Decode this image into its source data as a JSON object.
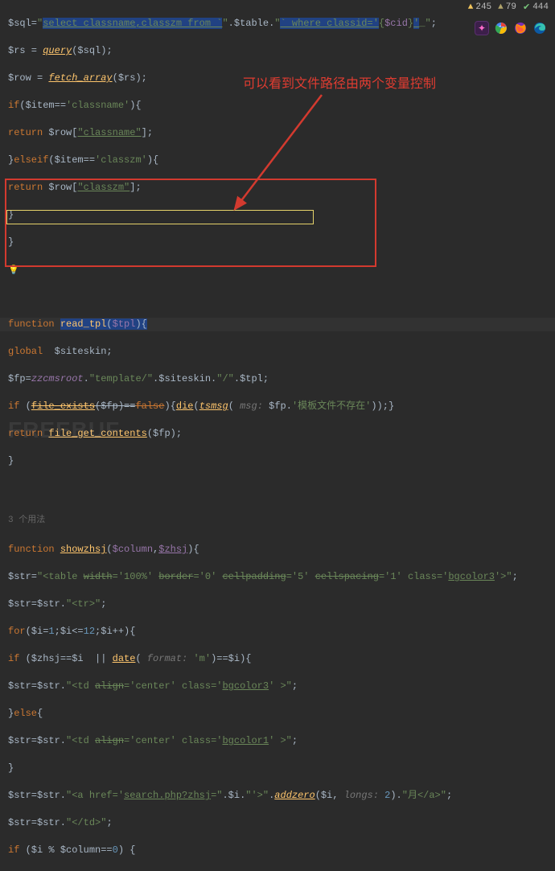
{
  "status": {
    "warn1_count": "245",
    "warn2_count": "79",
    "ok_count": "444"
  },
  "annotation": {
    "text": "可以看到文件路径由两个变量控制"
  },
  "usage_hint": "3 个用法",
  "watermark": "FREEBUF",
  "code": {
    "l01_a": "$sql=",
    "l01_b": "\"",
    "l01_c": "select classname,classzm from `",
    "l01_d": "\"",
    "l01_e": ".$table.",
    "l01_f": "\"",
    "l01_g": "` where classid='",
    "l01_h": "{",
    "l01_i": "$cid",
    "l01_j": "}",
    "l01_k": "'",
    "l01_l": "_\"",
    "l01_m": ";",
    "l02_a": "$rs = ",
    "l02_b": "query",
    "l02_c": "($sql);",
    "l03_a": "$row = ",
    "l03_b": "fetch_array",
    "l03_c": "($rs);",
    "l04_a": "if",
    "l04_b": "($item==",
    "l04_c": "'classname'",
    "l04_d": "){",
    "l05_a": "return",
    "l05_b": " $row[",
    "l05_c": "\"classname\"",
    "l05_d": "];",
    "l06_a": "}",
    "l06_b": "elseif",
    "l06_c": "($item==",
    "l06_d": "'classzm'",
    "l06_e": "){",
    "l07_a": "return",
    "l07_b": " $row[",
    "l07_c": "\"classzm\"",
    "l07_d": "];",
    "l08": "}",
    "l09": "}",
    "l12_a": "function ",
    "l12_b": "read_tpl",
    "l12_c": "(",
    "l12_d": "$tpl",
    "l12_e": "){",
    "l13_a": "global ",
    "l13_b": " $siteskin;",
    "l14_a": "$fp=",
    "l14_b": "zzcmsroot",
    "l14_c": ".",
    "l14_d": "\"template/\"",
    "l14_e": ".$siteskin.",
    "l14_f": "\"/\"",
    "l14_g": ".$tpl;",
    "l15_a": "if",
    "l15_b": " (",
    "l15_c": "file_exists",
    "l15_d": "(",
    "l15_e": "$fp",
    "l15_f": ")==",
    "l15_g": "false",
    "l15_h": "){",
    "l15_i": "die",
    "l15_j": "(",
    "l15_k": "tsmsg",
    "l15_l": "(",
    "l15_m": " msg: ",
    "l15_n": "$fp",
    "l15_o": ".",
    "l15_p": "'模板文件不存在'",
    "l15_q": "));}",
    "l16_a": "return",
    "l16_b": " ",
    "l16_c": "file_get_contents",
    "l16_d": "($fp);",
    "l17": "}",
    "l20_a": "function ",
    "l20_b": "showzhsj",
    "l20_c": "(",
    "l20_d": "$column",
    "l20_e": ",",
    "l20_f": "$zhsj",
    "l20_g": "){",
    "l21_a": "$str=",
    "l21_b": "\"<table ",
    "l21_c": "width",
    "l21_d": "='100%' ",
    "l21_e": "border",
    "l21_f": "='0' ",
    "l21_g": "cellpadding",
    "l21_h": "='5' ",
    "l21_i": "cellspacing",
    "l21_j": "='1' class='",
    "l21_k": "bgcolor3",
    "l21_l": "'>\"",
    "l21_m": ";",
    "l22_a": "$str=$str.",
    "l22_b": "\"<tr>\"",
    "l22_c": ";",
    "l23_a": "for",
    "l23_b": "($i=",
    "l23_c": "1",
    "l23_d": ";$i<=",
    "l23_e": "12",
    "l23_f": ";$i++){",
    "l24_a": "if",
    "l24_b": " ($zhsj==$i  || ",
    "l24_c": "date",
    "l24_d": "(",
    "l24_e": " format: ",
    "l24_f": "'m'",
    "l24_g": ")==$i){",
    "l25_a": "$str=$str.",
    "l25_b": "\"<td ",
    "l25_c": "align",
    "l25_d": "='center' class='",
    "l25_e": "bgcolor3",
    "l25_f": "' >\"",
    "l25_g": ";",
    "l26_a": "}",
    "l26_b": "else",
    "l26_c": "{",
    "l27_a": "$str=$str.",
    "l27_b": "\"<td ",
    "l27_c": "align",
    "l27_d": "='center' class='",
    "l27_e": "bgcolor1",
    "l27_f": "' >\"",
    "l27_g": ";",
    "l28": "}",
    "l29_a": "$str=$str.",
    "l29_b": "\"<a href='",
    "l29_c": "search.php?",
    "l29_d": "zhsj",
    "l29_e": "=\"",
    "l29_f": ".$i.",
    "l29_g": "\"'>\"",
    "l29_h": ".",
    "l29_i": "addzero",
    "l29_j": "($i,",
    "l29_k": " longs: ",
    "l29_l": "2",
    "l29_m": ").",
    "l29_n": "\"月</a>\"",
    "l29_o": ";",
    "l30_a": "$str=$str.",
    "l30_b": "\"</td>\"",
    "l30_c": ";",
    "l31_a": "if",
    "l31_b": " ($i % $column==",
    "l31_c": "0",
    "l31_d": ") {"
  }
}
